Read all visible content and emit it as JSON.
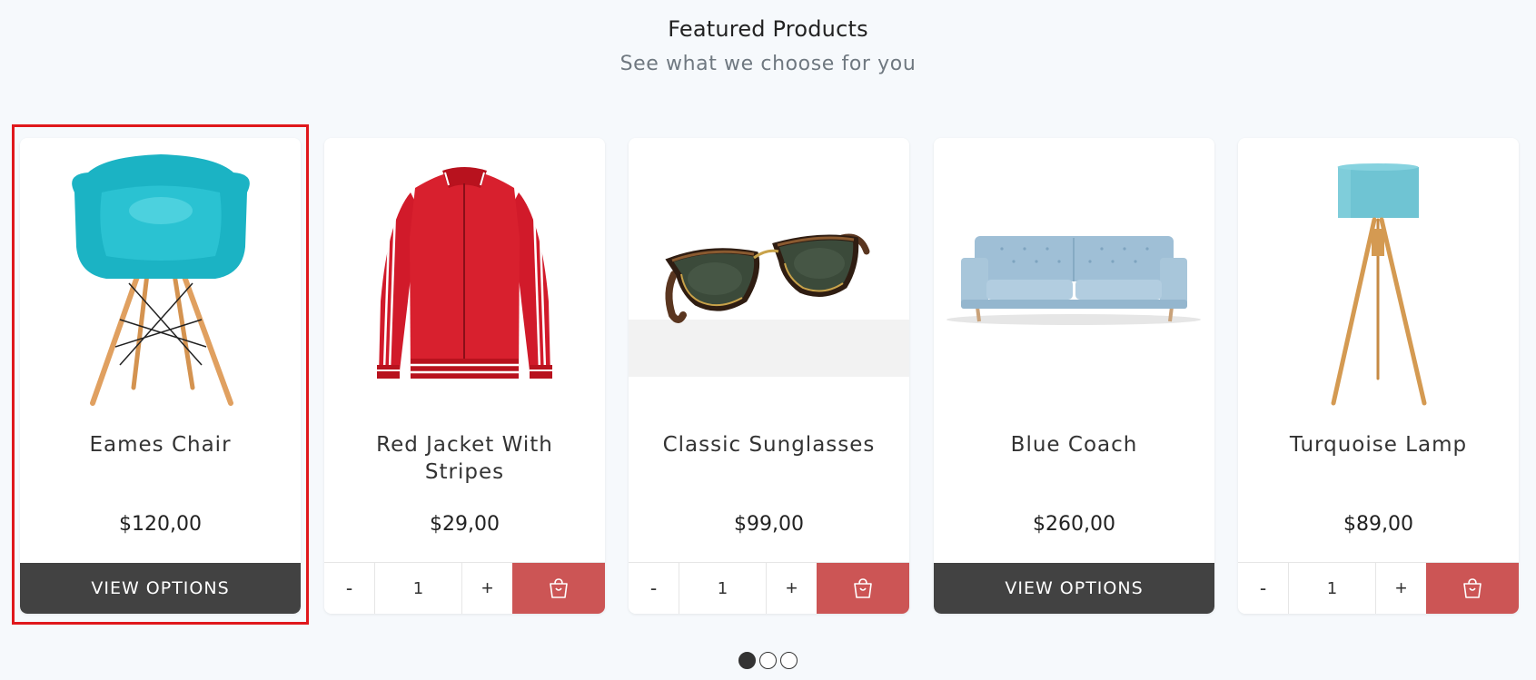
{
  "section": {
    "title": "Featured Products",
    "subtitle": "See what we choose for you"
  },
  "products": [
    {
      "name": "Eames Chair",
      "price": "$120,00",
      "action": "VIEW OPTIONS"
    },
    {
      "name": "Red Jacket With Stripes",
      "price": "$29,00",
      "quantity": "1",
      "minus": "-",
      "plus": "+",
      "cart_icon": "shopping-bag-icon"
    },
    {
      "name": "Classic Sunglasses",
      "price": "$99,00",
      "quantity": "1",
      "minus": "-",
      "plus": "+",
      "cart_icon": "shopping-bag-icon"
    },
    {
      "name": "Blue Coach",
      "price": "$260,00",
      "action": "VIEW OPTIONS"
    },
    {
      "name": "Turquoise Lamp",
      "price": "$89,00",
      "quantity": "1",
      "minus": "-",
      "plus": "+",
      "cart_icon": "shopping-bag-icon"
    }
  ],
  "carousel": {
    "pages": 3,
    "active_page": 1
  },
  "colors": {
    "background": "#f6f9fc",
    "view_options_button": "#424242",
    "add_to_cart_button": "#cc5555",
    "highlight": "#e0181c"
  }
}
